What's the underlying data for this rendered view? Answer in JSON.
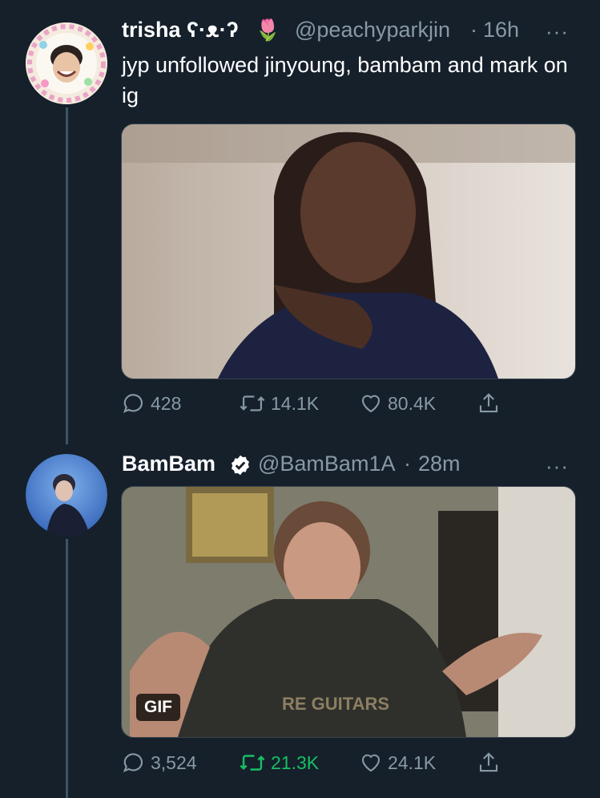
{
  "tweet1": {
    "display_name": "trisha ʕ·ᴥ·ʔ",
    "emoji": "🌷",
    "handle": "@peachyparkjin",
    "time_sep": "·",
    "time": "16h",
    "more": "···",
    "text": "jyp unfollowed jinyoung, bambam and mark on ig",
    "media_type": "image",
    "replies": "428",
    "retweets": "14.1K",
    "likes": "80.4K"
  },
  "tweet2": {
    "display_name": "BamBam",
    "verified": true,
    "handle": "@BamBam1A",
    "time_sep": "·",
    "time": "28m",
    "more": "···",
    "media_type": "gif",
    "gif_label": "GIF",
    "replies": "3,524",
    "retweets": "21.3K",
    "likes": "24.1K",
    "retweeted_color": "#17bf63"
  },
  "colors": {
    "background": "#15202b",
    "secondary_text": "#8899a6",
    "thread_line": "#3d5466"
  }
}
